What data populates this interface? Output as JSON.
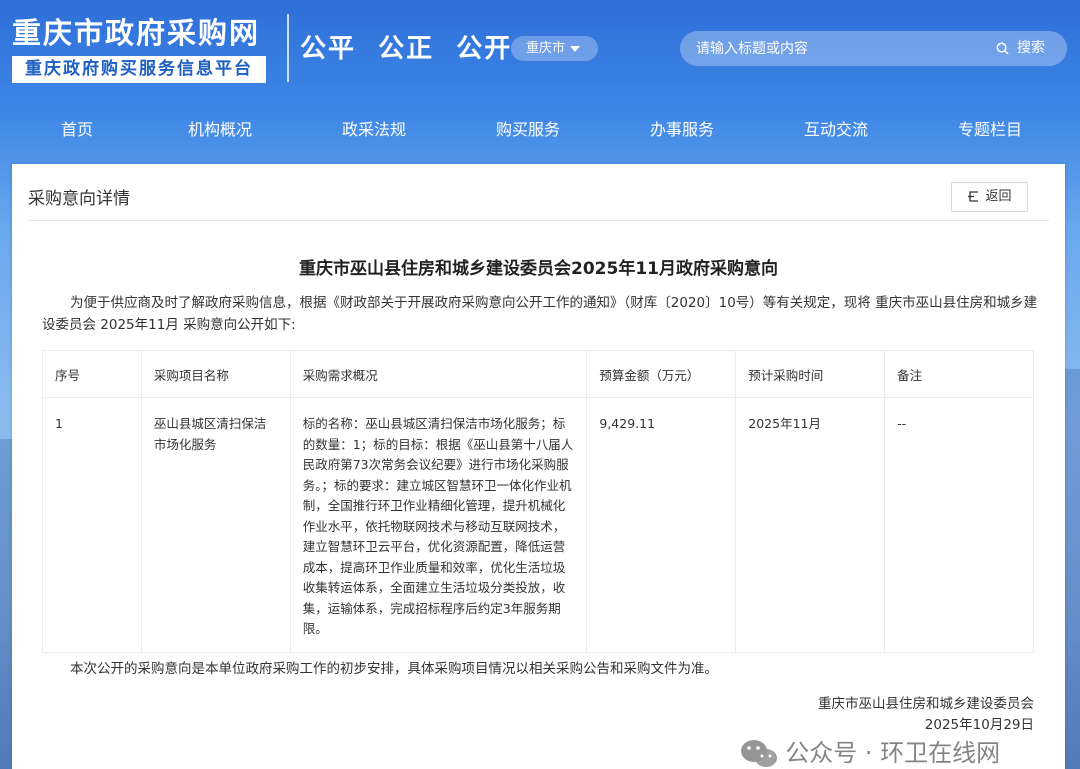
{
  "header": {
    "site_title": "重庆市政府采购网",
    "site_subtitle": "重庆政府购买服务信息平台",
    "slogan": "公平  公正  公开",
    "city_select": "重庆市",
    "search_placeholder": "请输入标题或内容",
    "search_button": "搜索"
  },
  "nav": {
    "items": [
      "首页",
      "机构概况",
      "政采法规",
      "购买服务",
      "办事服务",
      "互动交流",
      "专题栏目"
    ]
  },
  "panel": {
    "title": "采购意向详情",
    "back_button": "返回"
  },
  "document": {
    "title": "重庆市巫山县住房和城乡建设委员会2025年11月政府采购意向",
    "intro": "为便于供应商及时了解政府采购信息，根据《财政部关于开展政府采购意向公开工作的通知》（财库〔2020〕10号）等有关规定，现将 重庆市巫山县住房和城乡建设委员会 2025年11月 采购意向公开如下:",
    "table": {
      "headers": [
        "序号",
        "采购项目名称",
        "采购需求概况",
        "预算金额（万元）",
        "预计采购时间",
        "备注"
      ],
      "rows": [
        {
          "no": "1",
          "name": "巫山县城区清扫保洁市场化服务",
          "requirement": "标的名称：巫山县城区清扫保洁市场化服务；标的数量：1；标的目标：根据《巫山县第十八届人民政府第73次常务会议纪要》进行市场化采购服务。；标的要求：建立城区智慧环卫一体化作业机制，全国推行环卫作业精细化管理，提升机械化作业水平，依托物联网技术与移动互联网技术，建立智慧环卫云平台，优化资源配置，降低运营成本，提高环卫作业质量和效率，优化生活垃圾收集转运体系，全面建立生活垃圾分类投放，收集，运输体系，完成招标程序后约定3年服务期限。",
          "budget": "9,429.11",
          "time": "2025年11月",
          "remark": "--"
        }
      ]
    },
    "closing": "本次公开的采购意向是本单位政府采购工作的初步安排，具体采购项目情况以相关采购公告和采购文件为准。",
    "signer": "重庆市巫山县住房和城乡建设委员会",
    "date": "2025年10月29日"
  },
  "watermark": "公众号 · 环卫在线网"
}
